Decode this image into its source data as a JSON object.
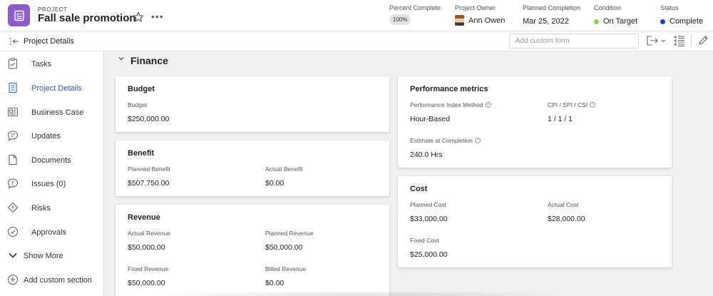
{
  "header": {
    "kicker": "PROJECT",
    "title": "Fall sale promotion",
    "percent_complete": {
      "label": "Percent Complete",
      "value": "100%"
    },
    "owner": {
      "label": "Project Owner",
      "value": "Ann Owen"
    },
    "planned_completion": {
      "label": "Planned Completion",
      "value": "Mar 25, 2022"
    },
    "condition": {
      "label": "Condition",
      "value": "On Target",
      "color": "#8fd14f"
    },
    "status": {
      "label": "Status",
      "value": "Complete",
      "color": "#1b3fd6"
    },
    "more": "•••"
  },
  "subbar": {
    "title": "Project Details",
    "custom_form_placeholder": "Add custom form"
  },
  "sidebar": {
    "items": [
      {
        "label": "Tasks",
        "icon": "tasks-icon"
      },
      {
        "label": "Project Details",
        "icon": "details-icon",
        "active": true
      },
      {
        "label": "Business Case",
        "icon": "business-case-icon"
      },
      {
        "label": "Updates",
        "icon": "updates-icon"
      },
      {
        "label": "Documents",
        "icon": "documents-icon"
      },
      {
        "label": "Issues (0)",
        "icon": "issues-icon"
      },
      {
        "label": "Risks",
        "icon": "risks-icon"
      },
      {
        "label": "Approvals",
        "icon": "approvals-icon"
      },
      {
        "label": "Show More",
        "icon": "chevron-down-icon"
      },
      {
        "label": "Add custom section",
        "icon": "plus-circle-icon"
      }
    ]
  },
  "finance": {
    "title": "Finance",
    "budget": {
      "title": "Budget",
      "budget_label": "Budget",
      "budget_value": "$250,000.00"
    },
    "benefit": {
      "title": "Benefit",
      "planned_label": "Planned Benefit",
      "planned_value": "$507,750.00",
      "actual_label": "Actual Benefit",
      "actual_value": "$0.00"
    },
    "revenue": {
      "title": "Revenue",
      "actual_label": "Actual Revenue",
      "actual_value": "$50,000.00",
      "planned_label": "Planned Revenue",
      "planned_value": "$50,000.00",
      "fixed_label": "Fixed Revenue",
      "fixed_value": "$50,000.00",
      "billed_label": "Billed Revenue",
      "billed_value": "$0.00"
    },
    "performance": {
      "title": "Performance metrics",
      "method_label": "Performance Index Method",
      "method_value": "Hour-Based",
      "cpi_label": "CPI / SPI / CSI",
      "cpi_value": "1 / 1 / 1",
      "eac_label": "Estimate at Completion",
      "eac_value": "240.0 Hrs"
    },
    "cost": {
      "title": "Cost",
      "planned_label": "Planned Cost",
      "planned_value": "$33,000.00",
      "actual_label": "Actual Cost",
      "actual_value": "$28,000.00",
      "fixed_label": "Fixed Cost",
      "fixed_value": "$25,000.00"
    }
  },
  "colors": {
    "brand": "#8e5cc9",
    "active_link": "#2b5fc9"
  }
}
